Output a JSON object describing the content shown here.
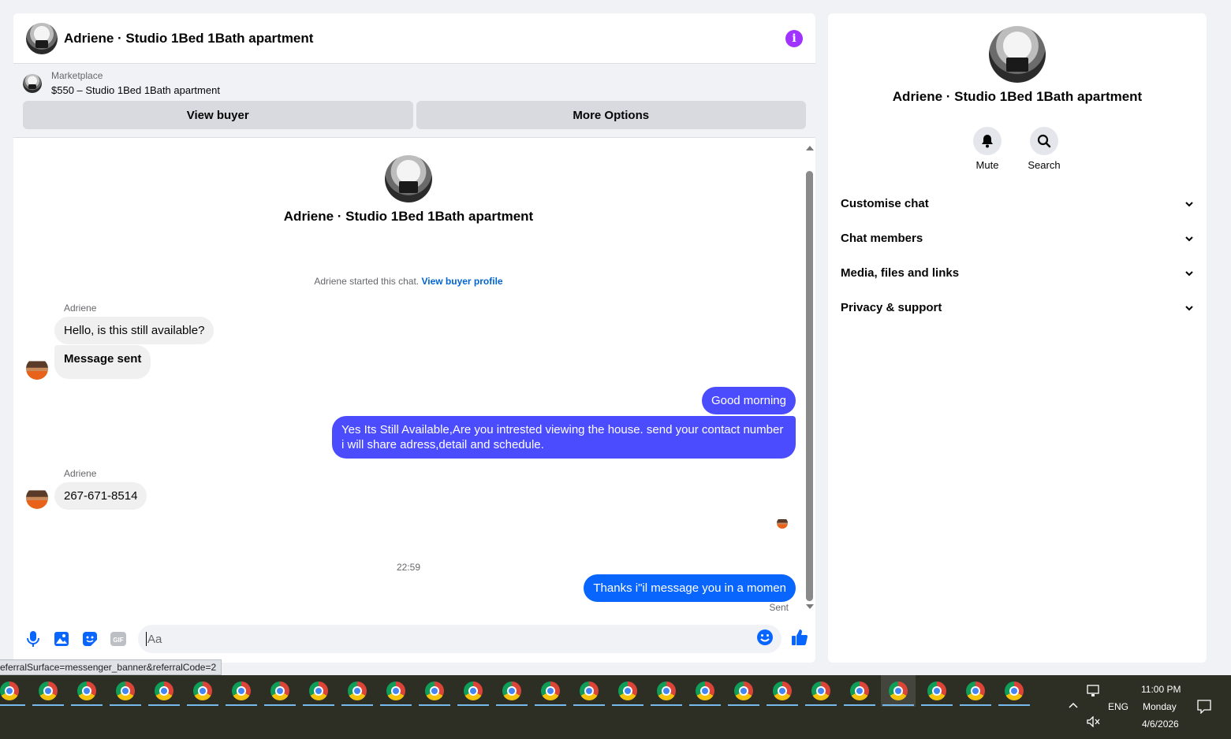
{
  "chat": {
    "title": "Adriene · Studio 1Bed 1Bath apartment",
    "marketplace_label": "Marketplace",
    "listing": "$550 – Studio 1Bed 1Bath apartment",
    "view_buyer": "View buyer",
    "more_options": "More Options",
    "intro_name": "Adriene · Studio 1Bed 1Bath apartment",
    "started_text": "Adriene started this chat. ",
    "started_link": "View buyer profile",
    "messages": [
      {
        "sender": "Adriene",
        "text": "Hello, is this still available?"
      },
      {
        "text": "Message sent"
      },
      {
        "text": "Good morning"
      },
      {
        "text": "Yes Its Still Available,Are you intrested viewing the house. send your contact number i will share adress,detail and schedule."
      },
      {
        "sender": "Adriene",
        "text": "267-671-8514"
      },
      {
        "text": "Thanks i\"il message you in a momen"
      }
    ],
    "timestamp": "22:59",
    "sent_label": "Sent",
    "input_placeholder": "Aa"
  },
  "status_url": "eferralSurface=messenger_banner&referralCode=2",
  "side": {
    "name": "Adriene · Studio 1Bed 1Bath apartment",
    "mute": "Mute",
    "search": "Search",
    "sections": [
      "Customise chat",
      "Chat members",
      "Media, files and links",
      "Privacy & support"
    ]
  },
  "taskbar": {
    "lang": "ENG",
    "time": "11:00 PM",
    "day": "Monday",
    "date": "4/6/2026"
  },
  "colors": {
    "accent": "#4c4cff",
    "accent_blue": "#0866ff",
    "info": "#a033ff"
  }
}
